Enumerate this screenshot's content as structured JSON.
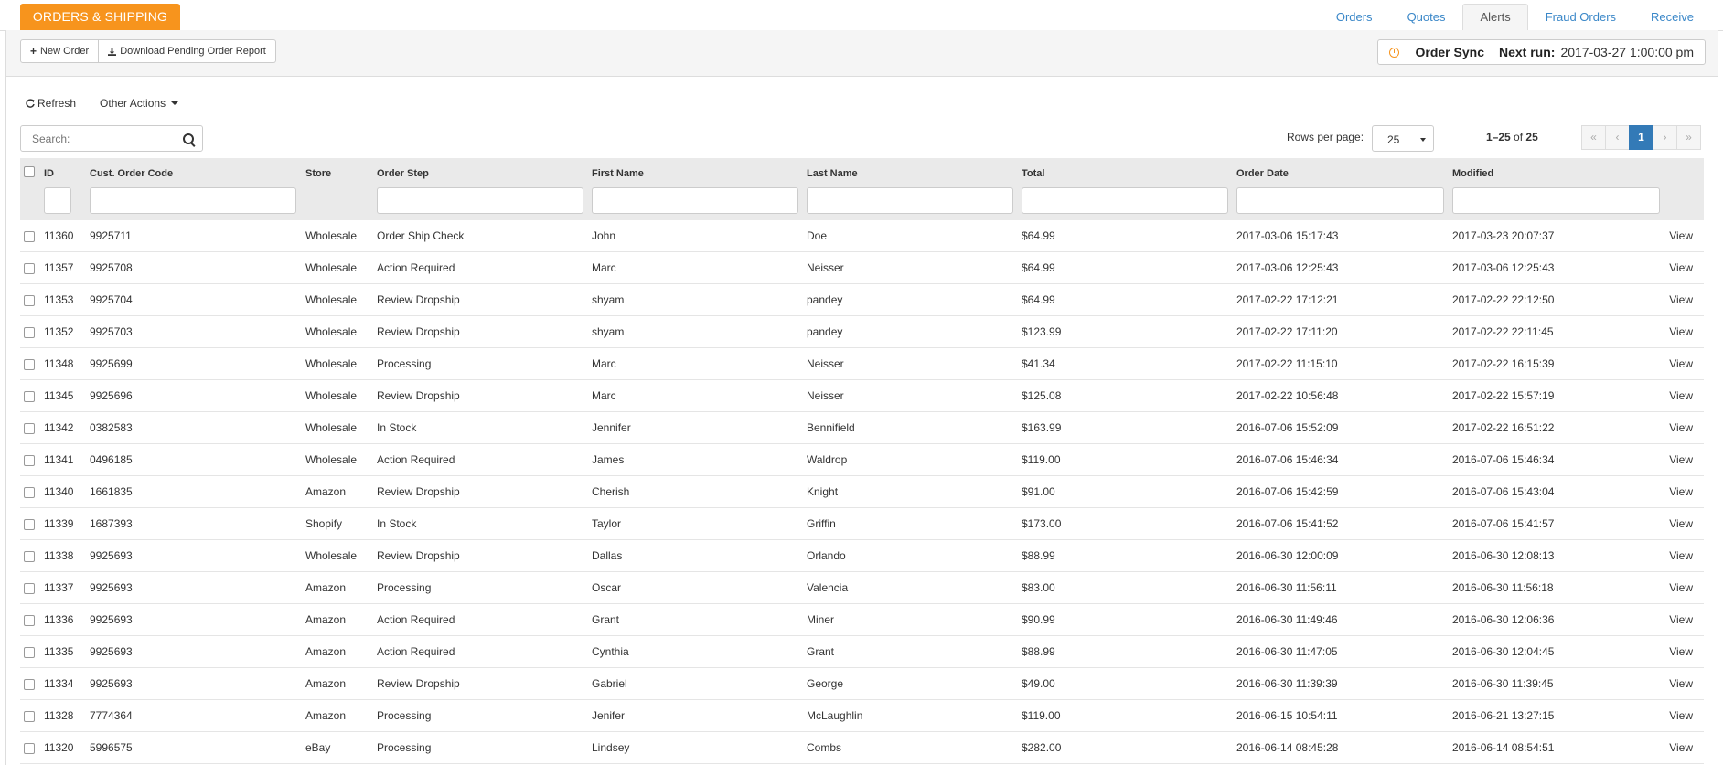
{
  "header": {
    "brand": "ORDERS & SHIPPING",
    "tabs": [
      "Orders",
      "Quotes",
      "Alerts",
      "Fraud Orders",
      "Receive"
    ],
    "active_tab": "Alerts"
  },
  "toolbar": {
    "new_order": "New Order",
    "download_report": "Download Pending Order Report",
    "sync_label": "Order Sync",
    "next_run_label": "Next run:",
    "next_run_value": "2017-03-27 1:00:00 pm"
  },
  "actions": {
    "refresh": "Refresh",
    "other_actions": "Other Actions"
  },
  "search": {
    "placeholder": "Search:"
  },
  "pagination": {
    "rows_per_page_label": "Rows per page:",
    "rows_per_page_value": "25",
    "range": "1–25",
    "of_label": "of",
    "total": "25",
    "current_page": "1",
    "first": "«",
    "prev": "‹",
    "next": "›",
    "last": "»"
  },
  "columns": [
    "ID",
    "Cust. Order Code",
    "Store",
    "Order Step",
    "First Name",
    "Last Name",
    "Total",
    "Order Date",
    "Modified"
  ],
  "view_label": "View",
  "rows": [
    [
      "11360",
      "9925711",
      "Wholesale",
      "Order Ship Check",
      "John",
      "Doe",
      "$64.99",
      "2017-03-06 15:17:43",
      "2017-03-23 20:07:37"
    ],
    [
      "11357",
      "9925708",
      "Wholesale",
      "Action Required",
      "Marc",
      "Neisser",
      "$64.99",
      "2017-03-06 12:25:43",
      "2017-03-06 12:25:43"
    ],
    [
      "11353",
      "9925704",
      "Wholesale",
      "Review Dropship",
      "shyam",
      "pandey",
      "$64.99",
      "2017-02-22 17:12:21",
      "2017-02-22 22:12:50"
    ],
    [
      "11352",
      "9925703",
      "Wholesale",
      "Review Dropship",
      "shyam",
      "pandey",
      "$123.99",
      "2017-02-22 17:11:20",
      "2017-02-22 22:11:45"
    ],
    [
      "11348",
      "9925699",
      "Wholesale",
      "Processing",
      "Marc",
      "Neisser",
      "$41.34",
      "2017-02-22 11:15:10",
      "2017-02-22 16:15:39"
    ],
    [
      "11345",
      "9925696",
      "Wholesale",
      "Review Dropship",
      "Marc",
      "Neisser",
      "$125.08",
      "2017-02-22 10:56:48",
      "2017-02-22 15:57:19"
    ],
    [
      "11342",
      "0382583",
      "Wholesale",
      "In Stock",
      "Jennifer",
      "Bennifield",
      "$163.99",
      "2016-07-06 15:52:09",
      "2017-02-22 16:51:22"
    ],
    [
      "11341",
      "0496185",
      "Wholesale",
      "Action Required",
      "James",
      "Waldrop",
      "$119.00",
      "2016-07-06 15:46:34",
      "2016-07-06 15:46:34"
    ],
    [
      "11340",
      "1661835",
      "Amazon",
      "Review Dropship",
      "Cherish",
      "Knight",
      "$91.00",
      "2016-07-06 15:42:59",
      "2016-07-06 15:43:04"
    ],
    [
      "11339",
      "1687393",
      "Shopify",
      "In Stock",
      "Taylor",
      "Griffin",
      "$173.00",
      "2016-07-06 15:41:52",
      "2016-07-06 15:41:57"
    ],
    [
      "11338",
      "9925693",
      "Wholesale",
      "Review Dropship",
      "Dallas",
      "Orlando",
      "$88.99",
      "2016-06-30 12:00:09",
      "2016-06-30 12:08:13"
    ],
    [
      "11337",
      "9925693",
      "Amazon",
      "Processing",
      "Oscar",
      "Valencia",
      "$83.00",
      "2016-06-30 11:56:11",
      "2016-06-30 11:56:18"
    ],
    [
      "11336",
      "9925693",
      "Amazon",
      "Action Required",
      "Grant",
      "Miner",
      "$90.99",
      "2016-06-30 11:49:46",
      "2016-06-30 12:06:36"
    ],
    [
      "11335",
      "9925693",
      "Amazon",
      "Action Required",
      "Cynthia",
      "Grant",
      "$88.99",
      "2016-06-30 11:47:05",
      "2016-06-30 12:04:45"
    ],
    [
      "11334",
      "9925693",
      "Amazon",
      "Review Dropship",
      "Gabriel",
      "George",
      "$49.00",
      "2016-06-30 11:39:39",
      "2016-06-30 11:39:45"
    ],
    [
      "11328",
      "7774364",
      "Amazon",
      "Processing",
      "Jenifer",
      "McLaughlin",
      "$119.00",
      "2016-06-15 10:54:11",
      "2016-06-21 13:27:15"
    ],
    [
      "11320",
      "5996575",
      "eBay",
      "Processing",
      "Lindsey",
      "Combs",
      "$282.00",
      "2016-06-14 08:45:28",
      "2016-06-14 08:54:51"
    ]
  ]
}
